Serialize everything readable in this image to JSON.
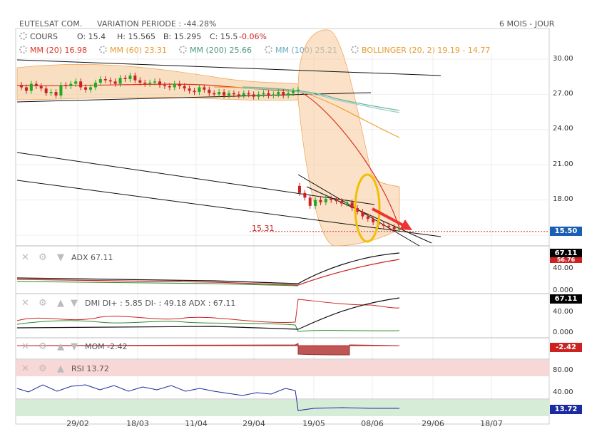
{
  "header": {
    "title": "EUTELSAT COM.",
    "variation": "VARIATION PERIODE : -44.28%",
    "period": "6 MOIS - JOUR"
  },
  "legend": {
    "cours": "COURS",
    "open": "O: 15.4",
    "high": "H: 15.565",
    "low": "B: 15.295",
    "close": "C: 15.5",
    "change": "-0.06%",
    "mm20": "MM (20) 16.98",
    "mm60": "MM (60) 23.31",
    "mm200": "MM (200) 25.66",
    "mm100": "MM (100) 25.21",
    "boll": "BOLLINGER (20, 2) 19.19 - 14.77"
  },
  "colors": {
    "up": "#22aa22",
    "down": "#cc2222",
    "mm20": "#dd3322",
    "mm60": "#f0a030",
    "mm200": "#6ab89a",
    "mm100": "#99cccc",
    "boll": "#f5c99a",
    "last": "#1a5fb4",
    "rsi": "#1a2aa0"
  },
  "price_axis": {
    "ticks": [
      "30.00",
      "27.00",
      "24.00",
      "21.00",
      "18.00",
      "15.00"
    ],
    "last_badge": "15.50",
    "ref_line": "15.31"
  },
  "x_axis": {
    "ticks": [
      "29/02",
      "18/03",
      "11/04",
      "29/04",
      "19/05",
      "08/06",
      "29/06",
      "18/07"
    ]
  },
  "panels": {
    "adx": {
      "label": "ADX",
      "value": "67.11",
      "ticks": [
        "40.00",
        "0.000"
      ],
      "badge1": "67.11",
      "badge2": "56.76"
    },
    "dmi": {
      "label": "DMI DI+ : 5.85 DI- : 49.18 ADX : 67.11",
      "ticks": [
        "40.00",
        "0.000"
      ],
      "badge": "67.11"
    },
    "mom": {
      "label": "MOM",
      "value": "-2.42",
      "badge": "-2.42"
    },
    "rsi": {
      "label": "RSI",
      "value": "13.72",
      "ticks": [
        "80.00",
        "40.00"
      ],
      "badge": "13.72"
    }
  },
  "chart_data": {
    "type": "candlestick",
    "title": "EUTELSAT COM.",
    "ylim": [
      14.5,
      31.5
    ],
    "y_ticks": [
      30,
      27,
      24,
      21,
      18,
      15
    ],
    "x_ticks": [
      "29/02",
      "18/03",
      "11/04",
      "29/04",
      "19/05",
      "08/06",
      "29/06",
      "18/07"
    ],
    "last_price": 15.5,
    "reference_price": 15.31,
    "summary": {
      "open": 15.4,
      "high": 15.565,
      "low": 15.295,
      "close": 15.5,
      "change_pct": -0.06
    },
    "indicators": {
      "MM20": 16.98,
      "MM60": 23.31,
      "MM200": 25.66,
      "MM100": 25.21,
      "Bollinger_upper": 19.19,
      "Bollinger_lower": 14.77,
      "ADX": 67.11,
      "DI_plus": 5.85,
      "DI_minus": 49.18,
      "MOM": -2.42,
      "RSI": 13.72
    },
    "closes_phase1": [
      27.6,
      27.3,
      27.9,
      27.7,
      27.5,
      27.1,
      27.2,
      26.9,
      27.8,
      27.7,
      27.9,
      28.1,
      27.6,
      27.4,
      27.6,
      28.0,
      28.3,
      28.2,
      28.1,
      27.9,
      28.4,
      28.3,
      28.6,
      28.2,
      28.0,
      27.9,
      28.0,
      28.1,
      27.8,
      27.7,
      27.6,
      27.9,
      27.7,
      27.5,
      27.3,
      27.2,
      27.6,
      27.4,
      27.1,
      27.0,
      27.2,
      26.9,
      27.1,
      27.0,
      26.9,
      27.1,
      27.0,
      26.8,
      27.0,
      27.1,
      26.9,
      27.0,
      27.2,
      26.9,
      27.1,
      27.3,
      27.4
    ],
    "closes_phase2": [
      18.6,
      18.2,
      17.5,
      18.0,
      17.8,
      18.1,
      18.0,
      17.9,
      17.7,
      17.8,
      17.3,
      17.0,
      16.6,
      16.4,
      16.1,
      15.9,
      15.8,
      15.7,
      15.5,
      15.5
    ]
  }
}
